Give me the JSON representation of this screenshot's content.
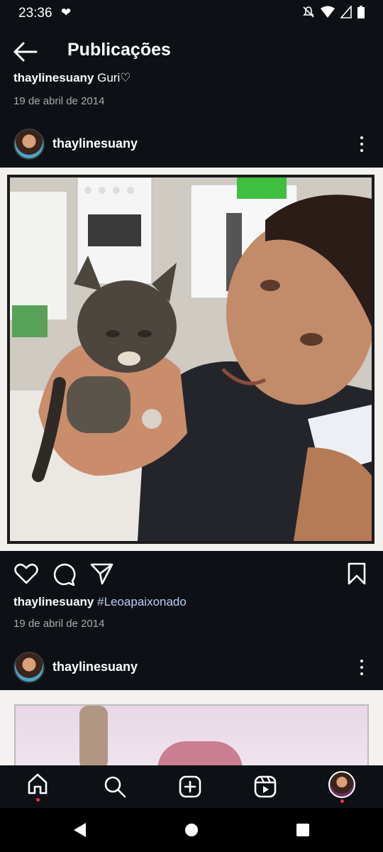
{
  "status_bar": {
    "time": "23:36"
  },
  "header": {
    "title": "Publicações"
  },
  "previous_post": {
    "username": "thaylinesuany",
    "caption": "Guri♡",
    "date": "19 de abril de 2014"
  },
  "post": {
    "username": "thaylinesuany",
    "caption_user": "thaylinesuany",
    "caption_text": "#Leoapaixonado",
    "date": "19 de abril de 2014",
    "image_alt": "Photo of a young man holding a tabby kitten in a kitchen"
  },
  "next_post": {
    "username": "thaylinesuany"
  },
  "colors": {
    "background": "#0d1014",
    "text": "#ffffff",
    "muted": "#a9abae",
    "hashtag": "#b8cdfc",
    "notification_dot": "#ff3040"
  },
  "icons": {
    "status": [
      "heart-pulse-icon",
      "mute-icon",
      "wifi-icon",
      "signal-icon",
      "battery-icon"
    ],
    "post_actions": [
      "like-icon",
      "comment-icon",
      "share-icon",
      "save-icon"
    ],
    "bottom_nav": [
      "home-icon",
      "search-icon",
      "create-icon",
      "reels-icon",
      "profile-avatar"
    ],
    "system_nav": [
      "back-triangle-icon",
      "home-circle-icon",
      "recents-square-icon"
    ]
  }
}
